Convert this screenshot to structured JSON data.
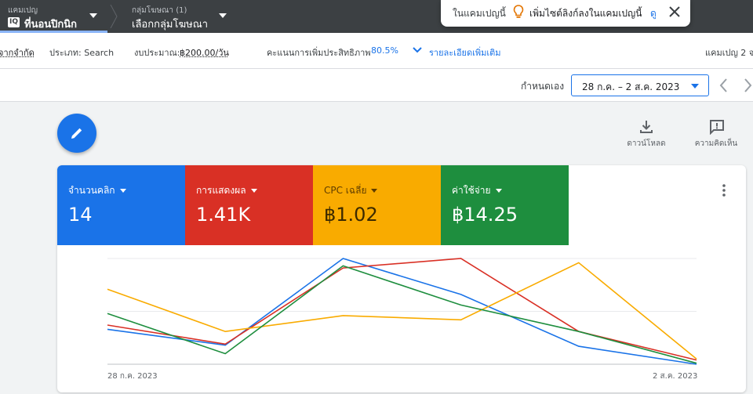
{
  "topbar": {
    "campaign_small": "แคมเปญ",
    "campaign_name": "ที่นอนปิกนิก",
    "campaign_logo": "IQ",
    "adgroup_small": "กลุ่มโฆษณา (1)",
    "adgroup_name": "เลือกกลุ่มโฆษณา"
  },
  "toast": {
    "prefix": "ในแคมเปญนี้",
    "message": "เพิ่มไซต์ลิงก์ลงในแคมเปญนี้",
    "link": "ดู"
  },
  "info": {
    "status": "จากจำกัด",
    "type": "ประเภท: Search",
    "budget_label": "งบประมาณ:",
    "budget_value": "฿200.00/วัน",
    "optimization_label": "คะแนนการเพิ่มประสิทธิภาพ",
    "optimization_value": "80.5%",
    "more_details": "รายละเอียดเพิ่มเติม",
    "campaign_count": "แคมเปญ 2 จ"
  },
  "date": {
    "label": "กำหนดเอง",
    "range": "28 ก.ค. – 2 ส.ค. 2023"
  },
  "tools": {
    "download": "ดาวน์โหลด",
    "feedback": "ความคิดเห็น"
  },
  "metrics": [
    {
      "label": "จำนวนคลิก",
      "value": "14",
      "color": "#1a73e8"
    },
    {
      "label": "การแสดงผล",
      "value": "1.41K",
      "color": "#d93025"
    },
    {
      "label": "CPC เฉลี่ย",
      "value": "฿1.02",
      "color": "#f9ab00"
    },
    {
      "label": "ค่าใช้จ่าย",
      "value": "฿14.25",
      "color": "#1e8e3e"
    }
  ],
  "chart_data": {
    "type": "line",
    "x": [
      "28 ก.ค. 2023",
      "29 ก.ค. 2023",
      "30 ก.ค. 2023",
      "31 ก.ค. 2023",
      "1 ส.ค. 2023",
      "2 ส.ค. 2023"
    ],
    "x_tick_labels": [
      "28 ก.ค. 2023",
      "2 ส.ค. 2023"
    ],
    "normalized": true,
    "ylim": [
      0,
      1
    ],
    "grid": true,
    "series": [
      {
        "name": "จำนวนคลิก",
        "color": "#1a73e8",
        "values": [
          0.33,
          0.18,
          1.0,
          0.66,
          0.17,
          0.0
        ]
      },
      {
        "name": "การแสดงผล",
        "color": "#d93025",
        "values": [
          0.37,
          0.19,
          0.91,
          1.0,
          0.31,
          0.04
        ]
      },
      {
        "name": "CPC เฉลี่ย",
        "color": "#f9ab00",
        "values": [
          0.71,
          0.31,
          0.46,
          0.42,
          0.96,
          0.05
        ]
      },
      {
        "name": "ค่าใช้จ่าย",
        "color": "#1e8e3e",
        "values": [
          0.48,
          0.1,
          0.93,
          0.56,
          0.31,
          0.01
        ]
      }
    ]
  }
}
